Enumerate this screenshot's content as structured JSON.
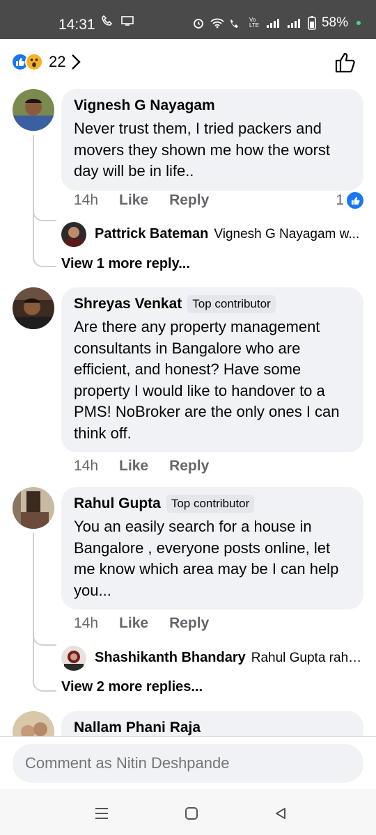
{
  "status_bar": {
    "time": "14:31",
    "battery": "58%",
    "network_label": "Vo LTE"
  },
  "reactions": {
    "count": "22",
    "icons": [
      "like-icon",
      "wow-icon"
    ]
  },
  "comments": [
    {
      "author": "Vignesh G Nayagam",
      "badge": "",
      "text": "Never trust them, I tried packers and movers they shown me how the worst day will be in life..",
      "time": "14h",
      "like_label": "Like",
      "reply_label": "Reply",
      "reaction_count": "1",
      "reply_preview": {
        "author": "Pattrick Bateman",
        "snippet": "Vignesh G Nayagam w..."
      },
      "view_more": "View 1 more reply..."
    },
    {
      "author": "Shreyas Venkat",
      "badge": "Top contributor",
      "text": "Are there any property management consultants in Bangalore who are efficient, and honest? Have some property I would like to handover to a PMS! NoBroker are the only ones I can think off.",
      "time": "14h",
      "like_label": "Like",
      "reply_label": "Reply"
    },
    {
      "author": "Rahul Gupta",
      "badge": "Top contributor",
      "text": "You  an easily search for a house in Bangalore , everyone posts online, let me know which area may be I can help you...",
      "time": "14h",
      "like_label": "Like",
      "reply_label": "Reply",
      "reply_preview": {
        "author": "Shashikanth Bhandary",
        "snippet": "Rahul Gupta rahul..."
      },
      "view_more": "View 2 more replies..."
    },
    {
      "author": "Nallam Phani Raja"
    }
  ],
  "composer": {
    "placeholder": "Comment as Nitin Deshpande"
  },
  "colors": {
    "bubble": "#f0f2f5",
    "accent": "#1877f2",
    "meta": "#65676b"
  }
}
